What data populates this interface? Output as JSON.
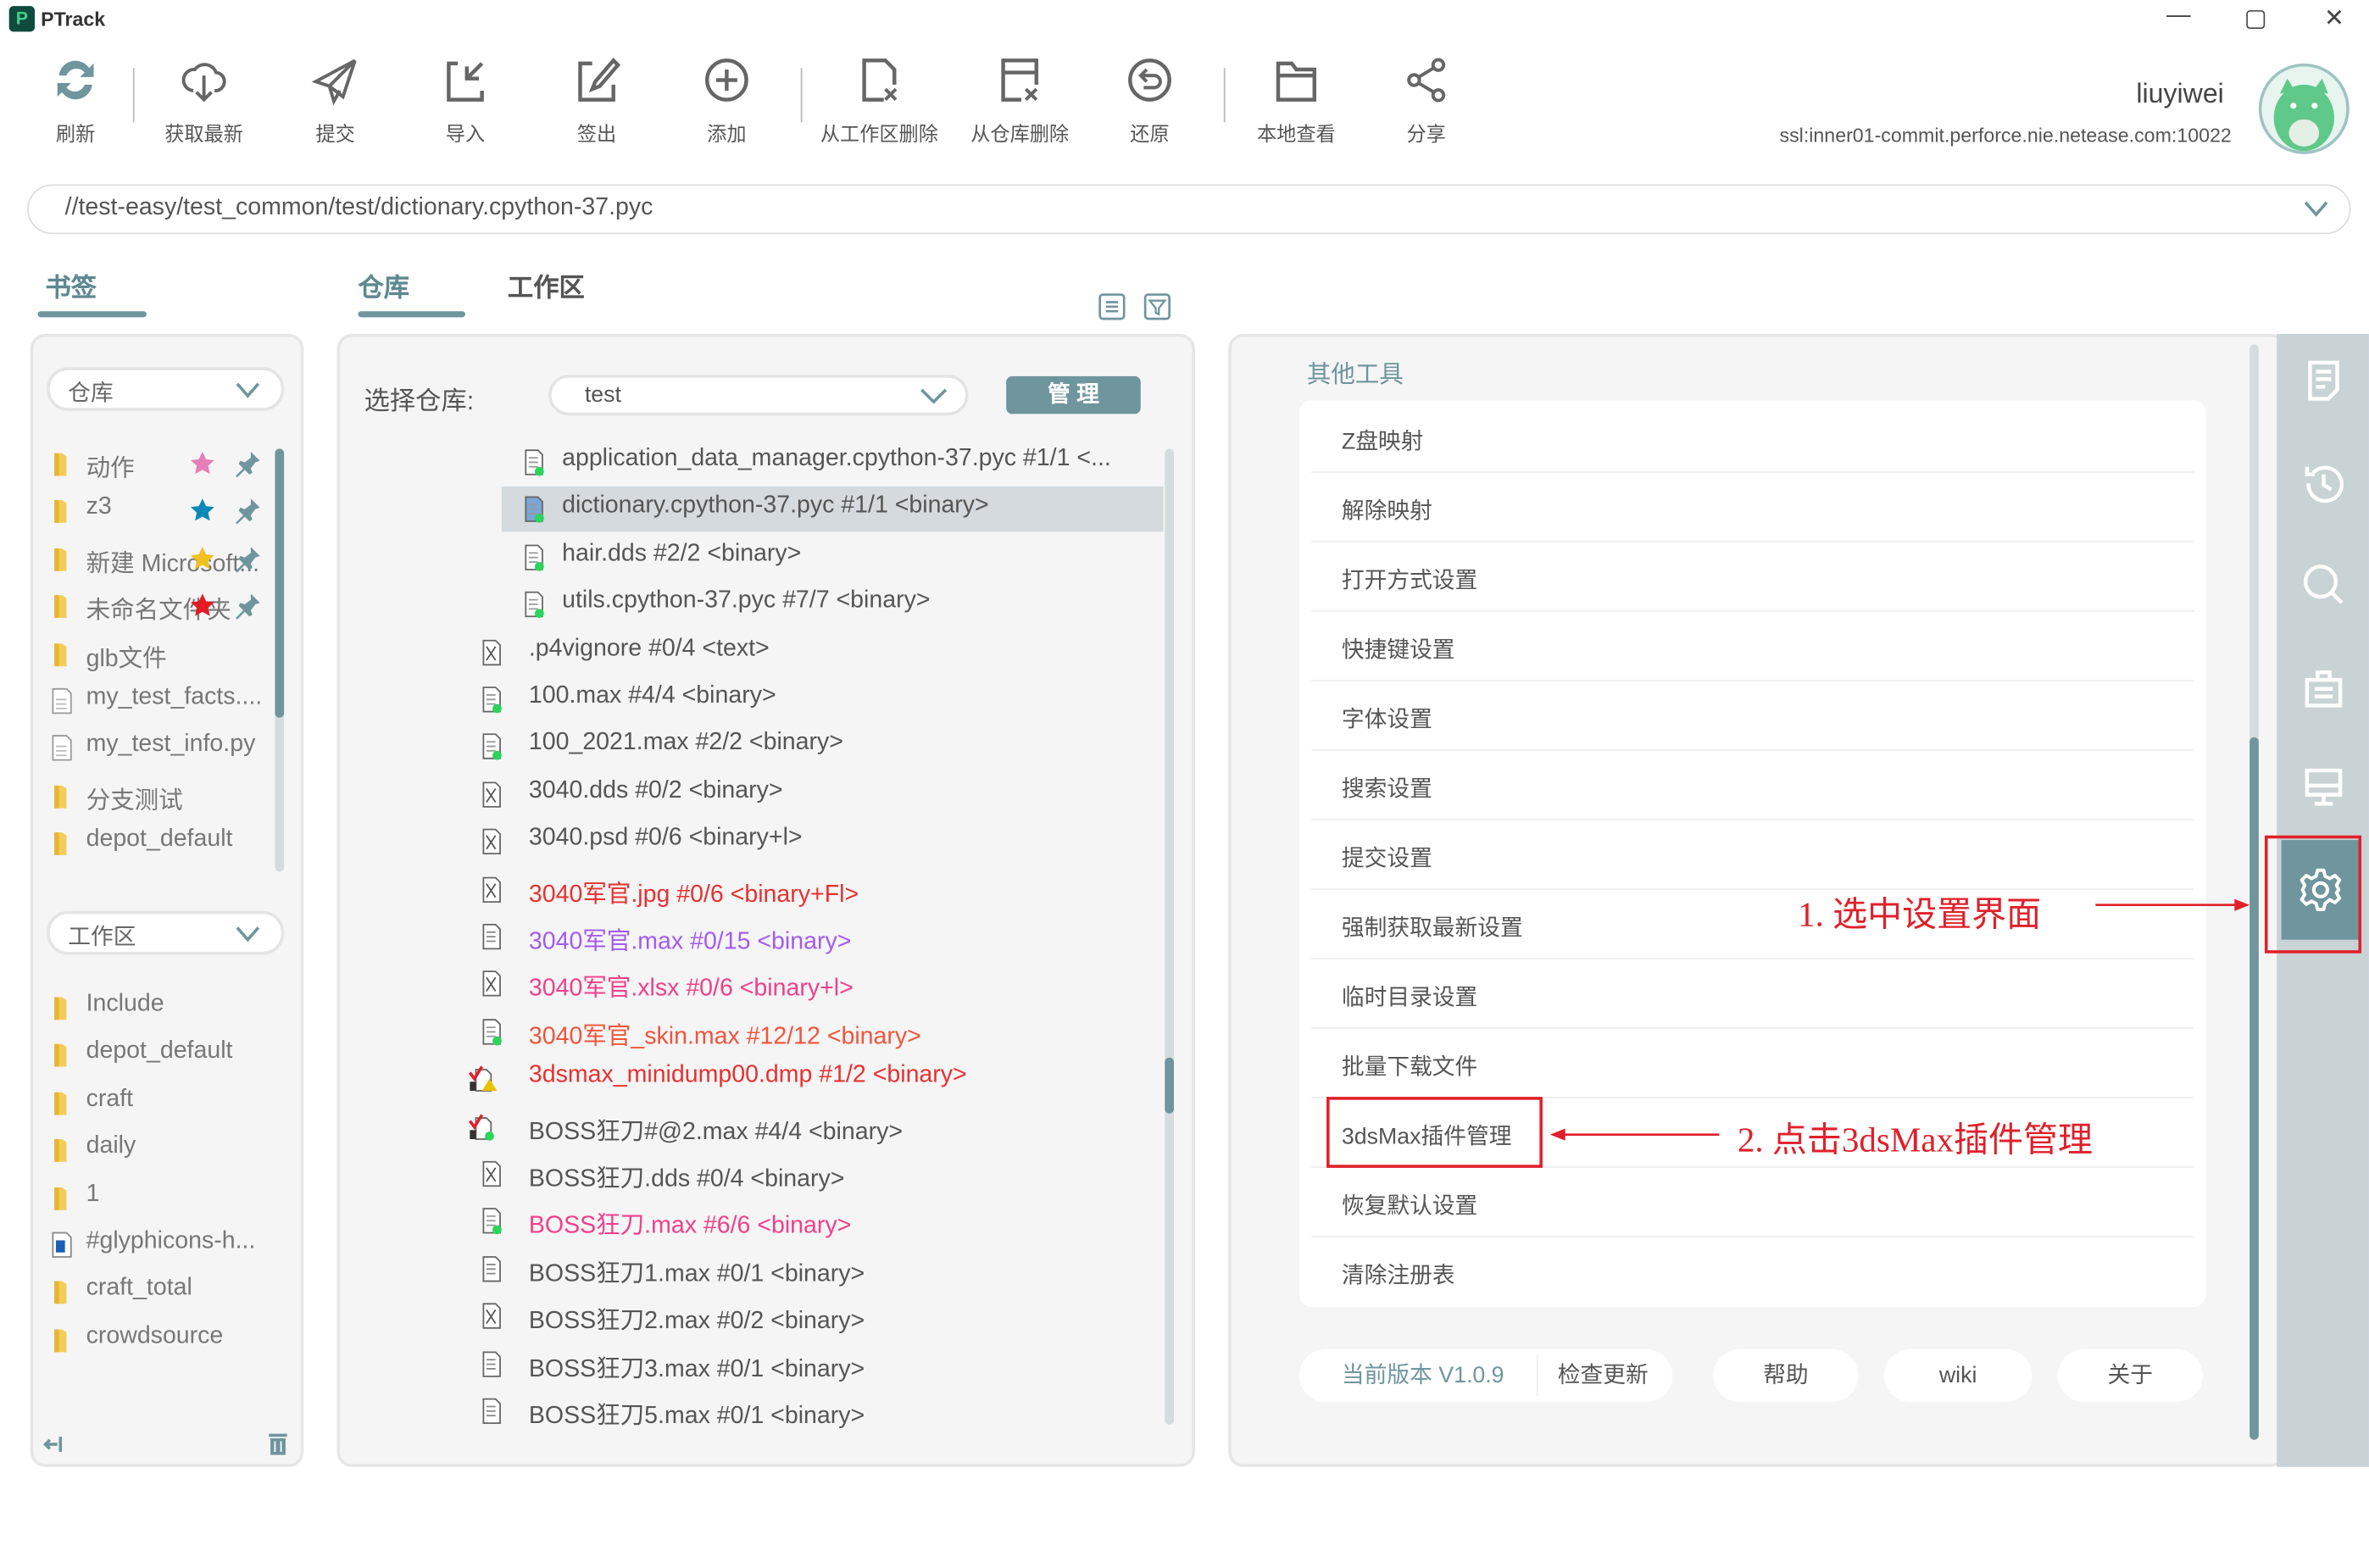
{
  "app": {
    "title": "PTrack",
    "logo_letter": "P"
  },
  "window_controls": [
    {
      "name": "minimize",
      "glyph": "—"
    },
    {
      "name": "maximize",
      "glyph": "▢"
    },
    {
      "name": "close",
      "glyph": "✕"
    }
  ],
  "toolbar": [
    {
      "id": "refresh",
      "label": "刷新",
      "icon": "refresh-icon"
    },
    {
      "id": "get-latest",
      "label": "获取最新",
      "icon": "cloud-download-icon"
    },
    {
      "id": "submit",
      "label": "提交",
      "icon": "paper-plane-icon"
    },
    {
      "id": "import",
      "label": "导入",
      "icon": "import-icon"
    },
    {
      "id": "checkout",
      "label": "签出",
      "icon": "edit-icon"
    },
    {
      "id": "add",
      "label": "添加",
      "icon": "plus-circle-icon"
    },
    {
      "id": "delete-workspace",
      "label": "从工作区删除",
      "icon": "file-delete-icon"
    },
    {
      "id": "delete-depot",
      "label": "从仓库删除",
      "icon": "box-delete-icon"
    },
    {
      "id": "revert",
      "label": "还原",
      "icon": "revert-icon"
    },
    {
      "id": "local-view",
      "label": "本地查看",
      "icon": "folder-icon"
    },
    {
      "id": "share",
      "label": "分享",
      "icon": "share-icon"
    }
  ],
  "user": {
    "name": "liuyiwei",
    "server": "ssl:inner01-commit.perforce.nie.netease.com:10022"
  },
  "path": {
    "value": "//test-easy/test_common/test/dictionary.cpython-37.pyc"
  },
  "tabs": {
    "bookmarks": "书签",
    "depot": "仓库",
    "workspace": "工作区"
  },
  "bookmarks": {
    "depot_dropdown": "仓库",
    "depot_items": [
      {
        "name": "动作",
        "type": "folder",
        "star": "#e57fb9",
        "pinned": true
      },
      {
        "name": "z3",
        "type": "folder",
        "star": "#0a88b8",
        "pinned": true
      },
      {
        "name": "新建 Microsoft...",
        "type": "folder",
        "star": "#f0c020",
        "pinned": true
      },
      {
        "name": "未命名文件夹",
        "type": "folder",
        "star": "#e31b23",
        "pinned": true
      },
      {
        "name": "glb文件",
        "type": "folder"
      },
      {
        "name": "my_test_facts....",
        "type": "file"
      },
      {
        "name": "my_test_info.py",
        "type": "file"
      },
      {
        "name": "分支测试",
        "type": "folder"
      },
      {
        "name": "depot_default",
        "type": "folder"
      }
    ],
    "workspace_dropdown": "工作区",
    "workspace_items": [
      {
        "name": "Include",
        "type": "folder"
      },
      {
        "name": "depot_default",
        "type": "folder"
      },
      {
        "name": "craft",
        "type": "folder"
      },
      {
        "name": "daily",
        "type": "folder"
      },
      {
        "name": "1",
        "type": "folder"
      },
      {
        "name": "#glyphicons-h...",
        "type": "image"
      },
      {
        "name": "craft_total",
        "type": "folder"
      },
      {
        "name": "crowdsource",
        "type": "folder"
      }
    ]
  },
  "depot": {
    "select_label": "选择仓库:",
    "selected_depot": "test",
    "manage_button": "管 理",
    "files": [
      {
        "text": "application_data_manager.cpython-37.pyc  #1/1 <...",
        "indent": true,
        "icon": "synced",
        "color": "#555555"
      },
      {
        "text": "dictionary.cpython-37.pyc  #1/1 <binary>",
        "indent": true,
        "icon": "synced-selected",
        "color": "#555555",
        "selected": true
      },
      {
        "text": "hair.dds  #2/2 <binary>",
        "indent": true,
        "icon": "synced",
        "color": "#555555"
      },
      {
        "text": "utils.cpython-37.pyc  #7/7 <binary>",
        "indent": true,
        "icon": "synced",
        "color": "#555555"
      },
      {
        "text": ".p4vignore  #0/4 <text>",
        "icon": "not-synced",
        "color": "#555555"
      },
      {
        "text": "100.max  #4/4 <binary>",
        "icon": "synced",
        "color": "#555555"
      },
      {
        "text": "100_2021.max  #2/2 <binary>",
        "icon": "synced",
        "color": "#555555"
      },
      {
        "text": "3040.dds  #0/2 <binary>",
        "icon": "not-synced",
        "color": "#555555"
      },
      {
        "text": "3040.psd  #0/6 <binary+l>",
        "icon": "not-synced",
        "color": "#555555"
      },
      {
        "text": "3040军官.jpg  #0/6 <binary+Fl>",
        "icon": "not-synced",
        "color": "#e8312f"
      },
      {
        "text": "3040军官.max  #0/15 <binary>",
        "icon": "plain",
        "color": "#a35bf0"
      },
      {
        "text": "3040军官.xlsx  #0/6 <binary+l>",
        "icon": "not-synced",
        "color": "#f0408a"
      },
      {
        "text": "3040军官_skin.max  #12/12 <binary>",
        "icon": "synced",
        "color": "#f0553b"
      },
      {
        "text": "3dsmax_minidump00.dmp  #1/2 <binary>",
        "icon": "checked-out-warning",
        "color": "#e8312f"
      },
      {
        "text": "BOSS狂刀#@2.max  #4/4 <binary>",
        "icon": "checked-out-synced",
        "color": "#555555"
      },
      {
        "text": "BOSS狂刀.dds  #0/4 <binary>",
        "icon": "not-synced",
        "color": "#555555"
      },
      {
        "text": "BOSS狂刀.max  #6/6 <binary>",
        "icon": "synced",
        "color": "#f0408a"
      },
      {
        "text": "BOSS狂刀1.max  #0/1 <binary>",
        "icon": "plain",
        "color": "#555555"
      },
      {
        "text": "BOSS狂刀2.max  #0/2 <binary>",
        "icon": "not-synced",
        "color": "#555555"
      },
      {
        "text": "BOSS狂刀3.max  #0/1 <binary>",
        "icon": "plain",
        "color": "#555555"
      },
      {
        "text": "BOSS狂刀5.max  #0/1 <binary>",
        "icon": "plain",
        "color": "#555555"
      }
    ]
  },
  "tools": {
    "heading": "其他工具",
    "items": [
      "Z盘映射",
      "解除映射",
      "打开方式设置",
      "快捷键设置",
      "字体设置",
      "搜索设置",
      "提交设置",
      "强制获取最新设置",
      "临时目录设置",
      "批量下载文件",
      "3dsMax插件管理",
      "恢复默认设置",
      "清除注册表"
    ],
    "version": "当前版本 V1.0.9",
    "check_update": "检查更新",
    "help": "帮助",
    "wiki": "wiki",
    "about": "关于"
  },
  "right_sidebar": [
    {
      "icon": "document-icon"
    },
    {
      "icon": "history-icon"
    },
    {
      "icon": "search-icon"
    },
    {
      "icon": "clipboard-icon"
    },
    {
      "icon": "monitor-icon"
    },
    {
      "icon": "gear-icon",
      "active": true
    }
  ],
  "annotations": {
    "step1": "1. 选中设置界面",
    "step2": "2. 点击3dsMax插件管理"
  },
  "colors": {
    "accent": "#6f959d",
    "annotation_red": "#e0202a",
    "selected_row": "#d4dadd",
    "sidebar_bg": "#c9d3d6"
  }
}
